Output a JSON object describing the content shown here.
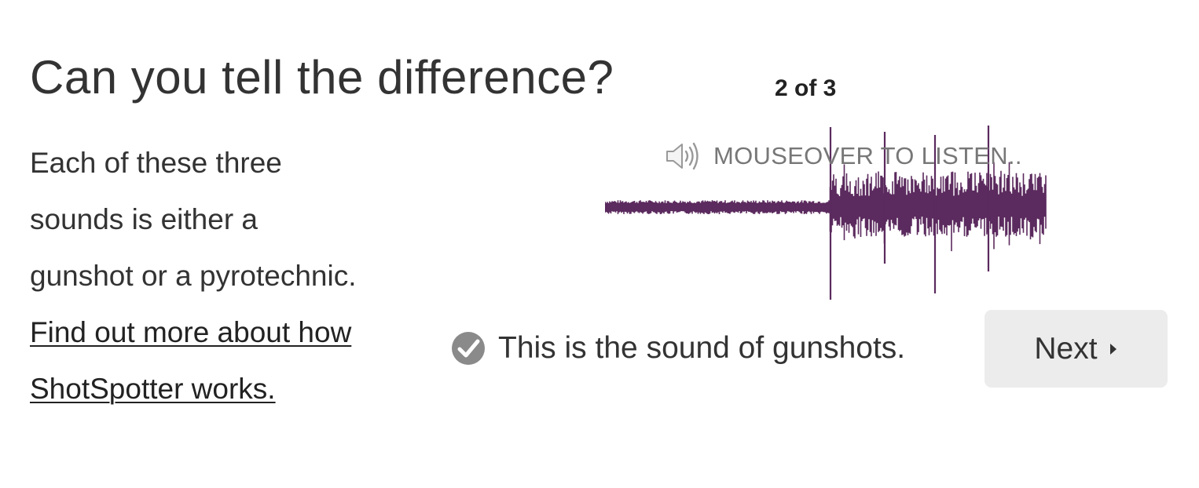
{
  "title": "Can you tell the difference?",
  "description": {
    "lines": [
      "Each of these three",
      "sounds is either a",
      "gunshot or a pyrotechnic."
    ],
    "link_lines": [
      "Find out more about how",
      "ShotSpotter works."
    ]
  },
  "quiz": {
    "counter": "2 of 3",
    "listen_prompt": "MOUSEOVER TO LISTEN..",
    "speaker_icon": "speaker-icon",
    "waveform_color": "#5b2a5e",
    "answer_icon": "check-circle-icon",
    "answer_text": "This is the sound of gunshots.",
    "next_label": "Next",
    "next_icon": "caret-right-icon"
  }
}
